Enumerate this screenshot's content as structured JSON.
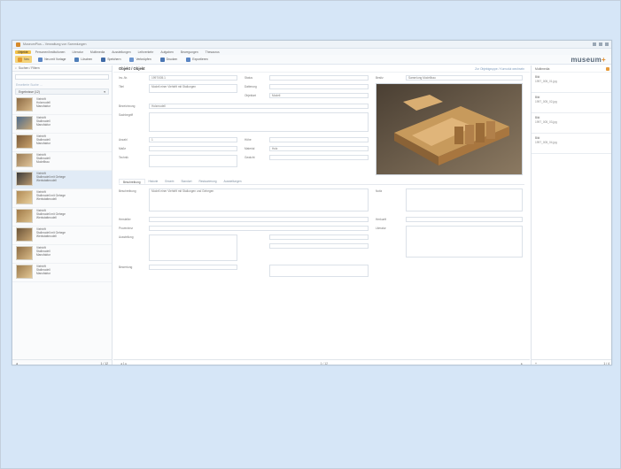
{
  "window": {
    "title": "MuseumPlus – Verwaltung von Sammlungen"
  },
  "menu": {
    "items": [
      "Objekte",
      "Personen/Institutionen",
      "Literatur",
      "Multimedia",
      "Ausstellungen",
      "Leihverkehr",
      "Aufgaben",
      "Bewegungen",
      "Thesaurus"
    ],
    "active_index": 0
  },
  "toolbar": {
    "buttons": [
      "Neu",
      "Neu mit Vorlage",
      "Löschen",
      "Speichern",
      "Verknüpfen",
      "Drucken",
      "Exportieren"
    ]
  },
  "logo": {
    "text": "museum",
    "dot": "+"
  },
  "left": {
    "header": "Suchen / Filtern",
    "search_placeholder": "",
    "link": "Erweiterte Suche …",
    "group_label": "Ergebnisse (12)",
    "items": [
      {
        "line1": "Viehtrift",
        "line2": "Holzmodell",
        "line3": "Manufaktur"
      },
      {
        "line1": "Viehtrift",
        "line2": "Stallmodell",
        "line3": "Manufaktur"
      },
      {
        "line1": "Viehtrift",
        "line2": "Stallmodell",
        "line3": "Manufaktur"
      },
      {
        "line1": "Viehtrift",
        "line2": "Stallmodell",
        "line3": "Modellbau"
      },
      {
        "line1": "Viehtrift",
        "line2": "Stallmodell mit Gehege",
        "line3": "Werkstattmodell"
      },
      {
        "line1": "Viehtrift",
        "line2": "Stallmodell mit Gehege",
        "line3": "Werkstattmodell"
      },
      {
        "line1": "Viehtrift",
        "line2": "Stallmodell mit Gehege",
        "line3": "Werkstattmodell"
      },
      {
        "line1": "Viehtrift",
        "line2": "Stallmodell mit Gehege",
        "line3": "Werkstattmodell"
      },
      {
        "line1": "Viehtrift",
        "line2": "Stallmodell",
        "line3": "Manufaktur"
      },
      {
        "line1": "Viehtrift",
        "line2": "Stallmodell",
        "line3": "Manufaktur"
      }
    ],
    "footer_left": "◂",
    "footer_right": "1 / 12"
  },
  "main": {
    "title": "Objekt / Objekt",
    "link": "Zur Objektgruppe / Konvolut wechseln",
    "fields": {
      "inv_label": "Inv.-Nr.",
      "inv_value": "1997/005.1",
      "status_label": "Status",
      "status_value": "",
      "besitz_label": "Besitz",
      "besitz_value": "Sammlung Modellbau",
      "titel_label": "Titel",
      "titel_value": "Modell einer Viehtrift mit Stallungen",
      "datierung_label": "Datierung",
      "datierung_value": "",
      "bez_label": "Bezeichnung",
      "bez_value": "Holzmodell",
      "sachbegriff_label": "Sachbegriff",
      "sachbegriff_value": "",
      "objektart_label": "Objektart",
      "objektart_value": "Modell",
      "anzahl_label": "Anzahl",
      "anzahl_value": "1",
      "hoehe_label": "Höhe",
      "hoehe_value": "",
      "masse_label": "Maße",
      "masse_value": "",
      "material_label": "Material",
      "material_value": "Holz",
      "technik_label": "Technik",
      "technik_value": "",
      "gewicht_label": "Gewicht",
      "gewicht_value": ""
    },
    "tabs": [
      "Beschreibung",
      "Historie",
      "Erwerb",
      "Standort",
      "Restaurierung",
      "Ausstellungen"
    ],
    "active_tab": 0,
    "lower": {
      "beschreibung_label": "Beschreibung",
      "beschreibung_value": "Modell einer Viehtrift mit Stallungen und Gehegen",
      "notiz_label": "Notiz",
      "notiz_value": "",
      "hersteller_label": "Hersteller",
      "hersteller_value": "",
      "herkunft_label": "Herkunft",
      "herkunft_value": "",
      "provenienz_label": "Provenienz",
      "provenienz_value": "",
      "literatur_label": "Literatur",
      "literatur_value": "",
      "ausstellung_label": "Ausstellung",
      "ausstellung_value": "",
      "bewertung_label": "Bewertung",
      "bewertung_value": "",
      "right_box1": "",
      "right_box2": "",
      "right_box3": ""
    },
    "footer_left": "◂ 1 ▸",
    "footer_mid": "1 / 12",
    "footer_right": "▸"
  },
  "right": {
    "header": "Multimedia",
    "items": [
      {
        "t1": "Bild",
        "t2": "1997_005_01.jpg"
      },
      {
        "t1": "Bild",
        "t2": "1997_005_02.jpg"
      },
      {
        "t1": "Bild",
        "t2": "1997_005_03.jpg"
      },
      {
        "t1": "Bild",
        "t2": "1997_005_04.jpg"
      }
    ],
    "footer_right": "1 / 4"
  }
}
